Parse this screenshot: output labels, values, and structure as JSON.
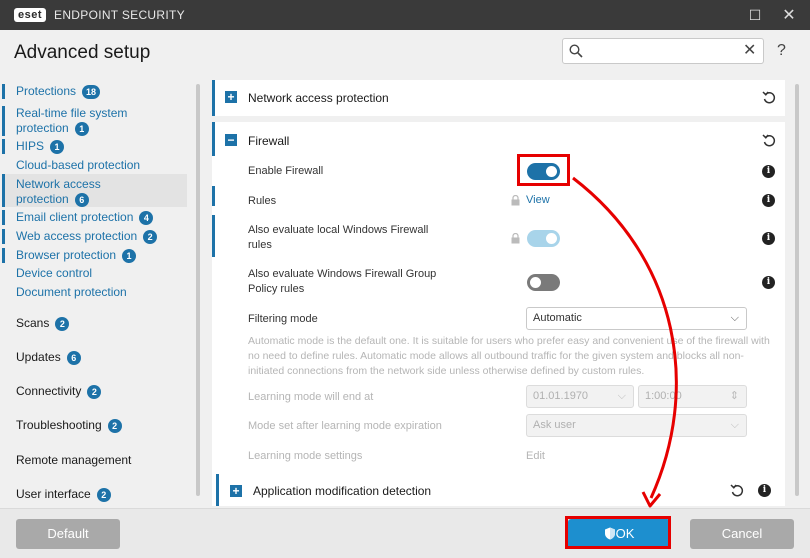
{
  "window": {
    "logo_text": "eset",
    "app_title": "ENDPOINT SECURITY",
    "maximize_glyph": "☐",
    "close_glyph": "✕"
  },
  "header": {
    "title": "Advanced setup",
    "search_placeholder": "",
    "search_clear_glyph": "✕",
    "help_glyph": "?"
  },
  "sidebar": {
    "protections": {
      "label": "Protections",
      "badge": "18"
    },
    "items": [
      {
        "label": "Real-time file system",
        "label2": "protection",
        "badge": "1"
      },
      {
        "label": "HIPS",
        "badge": "1"
      },
      {
        "label": "Cloud-based protection",
        "badge": ""
      },
      {
        "label": "Network access",
        "label2": "protection",
        "badge": "6"
      },
      {
        "label": "Email client protection",
        "badge": "4"
      },
      {
        "label": "Web access protection",
        "badge": "2"
      },
      {
        "label": "Browser protection",
        "badge": "1"
      },
      {
        "label": "Device control",
        "badge": ""
      },
      {
        "label": "Document protection",
        "badge": ""
      }
    ],
    "groups": [
      {
        "label": "Scans",
        "badge": "2"
      },
      {
        "label": "Updates",
        "badge": "6"
      },
      {
        "label": "Connectivity",
        "badge": "2"
      },
      {
        "label": "Troubleshooting",
        "badge": "2"
      },
      {
        "label": "Remote management",
        "badge": ""
      },
      {
        "label": "User interface",
        "badge": "2"
      }
    ]
  },
  "main": {
    "network_section": {
      "title": "Network access protection",
      "expand_glyph": "+"
    },
    "firewall_section": {
      "title": "Firewall",
      "collapse_glyph": "−",
      "enable_firewall": {
        "label": "Enable Firewall",
        "state": "on"
      },
      "rules": {
        "label": "Rules",
        "link": "View"
      },
      "local_rules": {
        "label": "Also evaluate local Windows Firewall",
        "label2": "rules",
        "state": "on-disabled"
      },
      "group_policy": {
        "label": "Also evaluate Windows Firewall Group",
        "label2": "Policy rules",
        "state": "off"
      },
      "filtering_mode": {
        "label": "Filtering mode",
        "value": "Automatic"
      },
      "description": "Automatic mode is the default one. It is suitable for users who prefer easy and convenient use of the firewall with no need to define rules. Automatic mode allows all outbound traffic for the given system and blocks all non-initiated connections from the network side unless otherwise defined by custom rules.",
      "learning_end": {
        "label": "Learning mode will end at",
        "date": "01.01.1970",
        "time": "1:00:00"
      },
      "mode_after": {
        "label": "Mode set after learning mode expiration",
        "value": "Ask user"
      },
      "learning_settings": {
        "label": "Learning mode settings",
        "link": "Edit"
      }
    },
    "app_mod_section": {
      "title": "Application modification detection",
      "expand_glyph": "+"
    }
  },
  "footer": {
    "default_label": "Default",
    "ok_label": "OK",
    "cancel_label": "Cancel"
  },
  "colors": {
    "accent": "#1d72a8",
    "annotation": "#e60000",
    "ok_button": "#1d8fcf"
  }
}
